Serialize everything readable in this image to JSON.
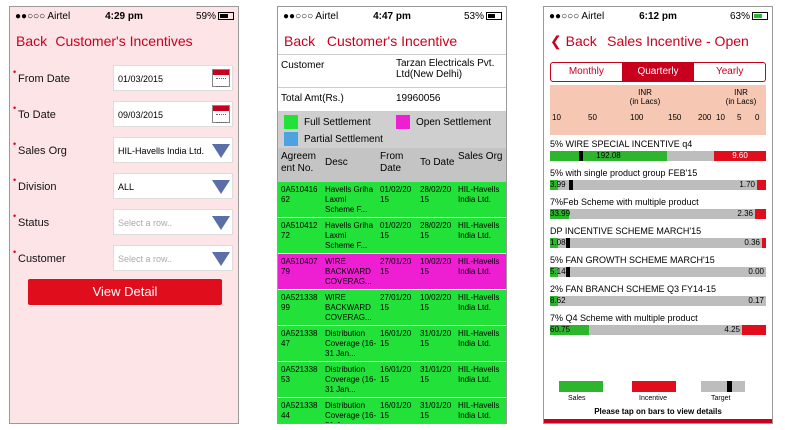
{
  "status_bar": {
    "carrier": "●●○○○ Airtel"
  },
  "screen1": {
    "time": "4:29 pm",
    "battery": "59%",
    "back": "Back",
    "title": "Customer's Incentives",
    "fields": [
      {
        "label": "From Date",
        "value": "01/03/2015",
        "icon": "calendar-icon"
      },
      {
        "label": "To Date",
        "value": "09/03/2015",
        "icon": "calendar-icon"
      },
      {
        "label": "Sales Org",
        "value": "HIL-Havells India Ltd.",
        "icon": "dropdown-icon"
      },
      {
        "label": "Division",
        "value": "ALL",
        "icon": "dropdown-icon"
      },
      {
        "label": "Status",
        "placeholder": "Select a row..",
        "icon": "dropdown-icon"
      },
      {
        "label": "Customer",
        "placeholder": "Select a row..",
        "icon": "dropdown-icon"
      }
    ],
    "button": "View Detail"
  },
  "screen2": {
    "time": "4:47 pm",
    "battery": "53%",
    "back": "Back",
    "title": "Customer's Incentive",
    "customer_label": "Customer",
    "customer_value": "Tarzan Electricals Pvt. Ltd(New Delhi)",
    "total_label": "Total Amt(Rs.)",
    "total_value": "19960056",
    "legend": {
      "full": "Full Settlement",
      "open": "Open Settlement",
      "partial": "Partial Settlement"
    },
    "headers": [
      "Agreement No.",
      "Desc",
      "From Date",
      "To Date",
      "Sales Org"
    ],
    "header_agreement": [
      "Agreem",
      "ent No."
    ],
    "rows": [
      {
        "no": "0A510416 62",
        "desc": "Havells Griha Laxmi Scheme F...",
        "from": "01/02/20 15",
        "to": "28/02/20 15",
        "org": "HIL-Havells India Ltd.",
        "color": "#22e23a"
      },
      {
        "no": "0A510412 72",
        "desc": "Havells Griha Laxmi Scheme F...",
        "from": "01/02/20 15",
        "to": "28/02/20 15",
        "org": "HIL-Havells India Ltd.",
        "color": "#22e23a"
      },
      {
        "no": "0A510407 79",
        "desc": "WIRE BACKWARD COVERAG...",
        "from": "27/01/20 15",
        "to": "10/02/20 15",
        "org": "HIL-Havells India Ltd.",
        "color": "#ee1fd3"
      },
      {
        "no": "0A521338 99",
        "desc": "WIRE BACKWARD COVERAG...",
        "from": "27/01/20 15",
        "to": "10/02/20 15",
        "org": "HIL-Havells India Ltd.",
        "color": "#22e23a"
      },
      {
        "no": "0A521338 47",
        "desc": "Distribution Coverage (16-31 Jan...",
        "from": "16/01/20 15",
        "to": "31/01/20 15",
        "org": "HIL-Havells India Ltd.",
        "color": "#22e23a"
      },
      {
        "no": "0A521338 53",
        "desc": "Distribution Coverage (16-31 Jan...",
        "from": "16/01/20 15",
        "to": "31/01/20 15",
        "org": "HIL-Havells India Ltd.",
        "color": "#22e23a"
      },
      {
        "no": "0A521338 44",
        "desc": "Distribution Coverage (16-31 Jan...",
        "from": "16/01/20 15",
        "to": "31/01/20 15",
        "org": "HIL-Havells India Ltd.",
        "color": "#22e23a"
      }
    ]
  },
  "screen3": {
    "time": "6:12 pm",
    "battery": "63%",
    "back": "Back",
    "title": "Sales Incentive - Open",
    "tabs": [
      "Monthly",
      "Quarterly",
      "Yearly"
    ],
    "active_tab": 1,
    "axis_left_title": [
      "INR",
      "(in Lacs)"
    ],
    "axis_right_title": [
      "INR",
      "(in Lacs)"
    ],
    "axis_left_ticks": [
      "10",
      "50",
      "100",
      "150",
      "200"
    ],
    "axis_right_ticks": [
      "10",
      "5",
      "0"
    ],
    "items": [
      {
        "name": "5% WIRE SPECIAL INCENTIVE q4",
        "sales": "192.08",
        "incentive": "9.60",
        "sales_frac": 0.72,
        "target_frac": 0.08,
        "inc_frac": 0.24
      },
      {
        "name": "5% with single product group FEB'15",
        "sales": "3.99",
        "incentive": "1.70",
        "sales_frac": 0.02,
        "target_frac": 0.02,
        "inc_frac": 0.04
      },
      {
        "name": "7%Feb Scheme  with multiple product",
        "sales": "33.99",
        "incentive": "2.36",
        "sales_frac": 0.12,
        "target_frac": null,
        "inc_frac": 0.05
      },
      {
        "name": "DP INCENTIVE  SCHEME MARCH'15",
        "sales": "1.08",
        "incentive": "0.36",
        "sales_frac": 0.0,
        "target_frac": 0.0,
        "inc_frac": 0.02
      },
      {
        "name": "5% FAN GROWTH SCHEME MARCH'15",
        "sales": "5.14",
        "incentive": "0.00",
        "sales_frac": 0.02,
        "target_frac": 0.0,
        "inc_frac": 0.0
      },
      {
        "name": "2% FAN BRANCH SCHEME Q3 FY14-15",
        "sales": "8.62",
        "incentive": "0.17",
        "sales_frac": 0.0,
        "target_frac": null,
        "inc_frac": 0.0
      },
      {
        "name": "7% Q4 Scheme  with multiple product",
        "sales": "60.75",
        "incentive": "4.25",
        "sales_frac": 0.24,
        "target_frac": null,
        "inc_frac": 0.11
      }
    ],
    "legend": {
      "sales": "Sales",
      "incentive": "Incentive",
      "target": "Target"
    },
    "hint": "Please tap on bars to view details"
  }
}
